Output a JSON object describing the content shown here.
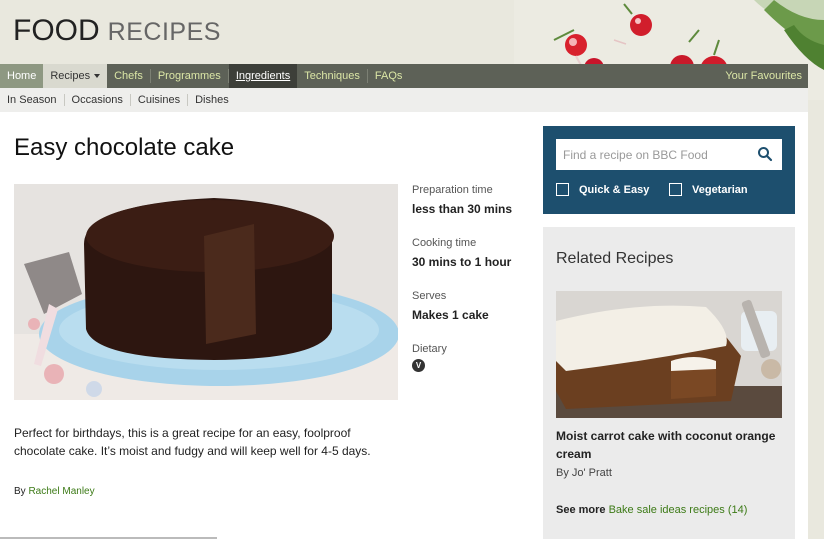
{
  "logo": {
    "food": "FOOD",
    "recipes": "RECIPES"
  },
  "mainnav": {
    "items": [
      "Home",
      "Recipes",
      "Chefs",
      "Programmes",
      "Ingredients",
      "Techniques",
      "FAQs"
    ],
    "favourites": "Your Favourites"
  },
  "subnav": {
    "items": [
      "In Season",
      "Occasions",
      "Cuisines",
      "Dishes"
    ]
  },
  "recipe": {
    "title": "Easy chocolate cake",
    "facts": [
      {
        "label": "Preparation time",
        "value": "less than 30 mins"
      },
      {
        "label": "Cooking time",
        "value": "30 mins to 1 hour"
      },
      {
        "label": "Serves",
        "value": "Makes 1 cake"
      },
      {
        "label": "Dietary",
        "badge": "V"
      }
    ],
    "description": "Perfect for birthdays, this is a great recipe for an easy, foolproof chocolate cake. It’s moist and fudgy and will keep well for 4-5 days.",
    "by_label": "By",
    "author": "Rachel Manley"
  },
  "search": {
    "placeholder": "Find a recipe on BBC Food",
    "filters": [
      "Quick & Easy",
      "Vegetarian"
    ]
  },
  "related": {
    "heading": "Related Recipes",
    "title": "Moist carrot cake with coconut orange cream",
    "by": "By Jo' Pratt",
    "see_more_label": "See more",
    "see_more_link": "Bake sale ideas recipes (14)"
  },
  "colors": {
    "nav_bg": "#5d6157",
    "link_green": "#3c7a16",
    "search_bg": "#1d4f6e"
  }
}
